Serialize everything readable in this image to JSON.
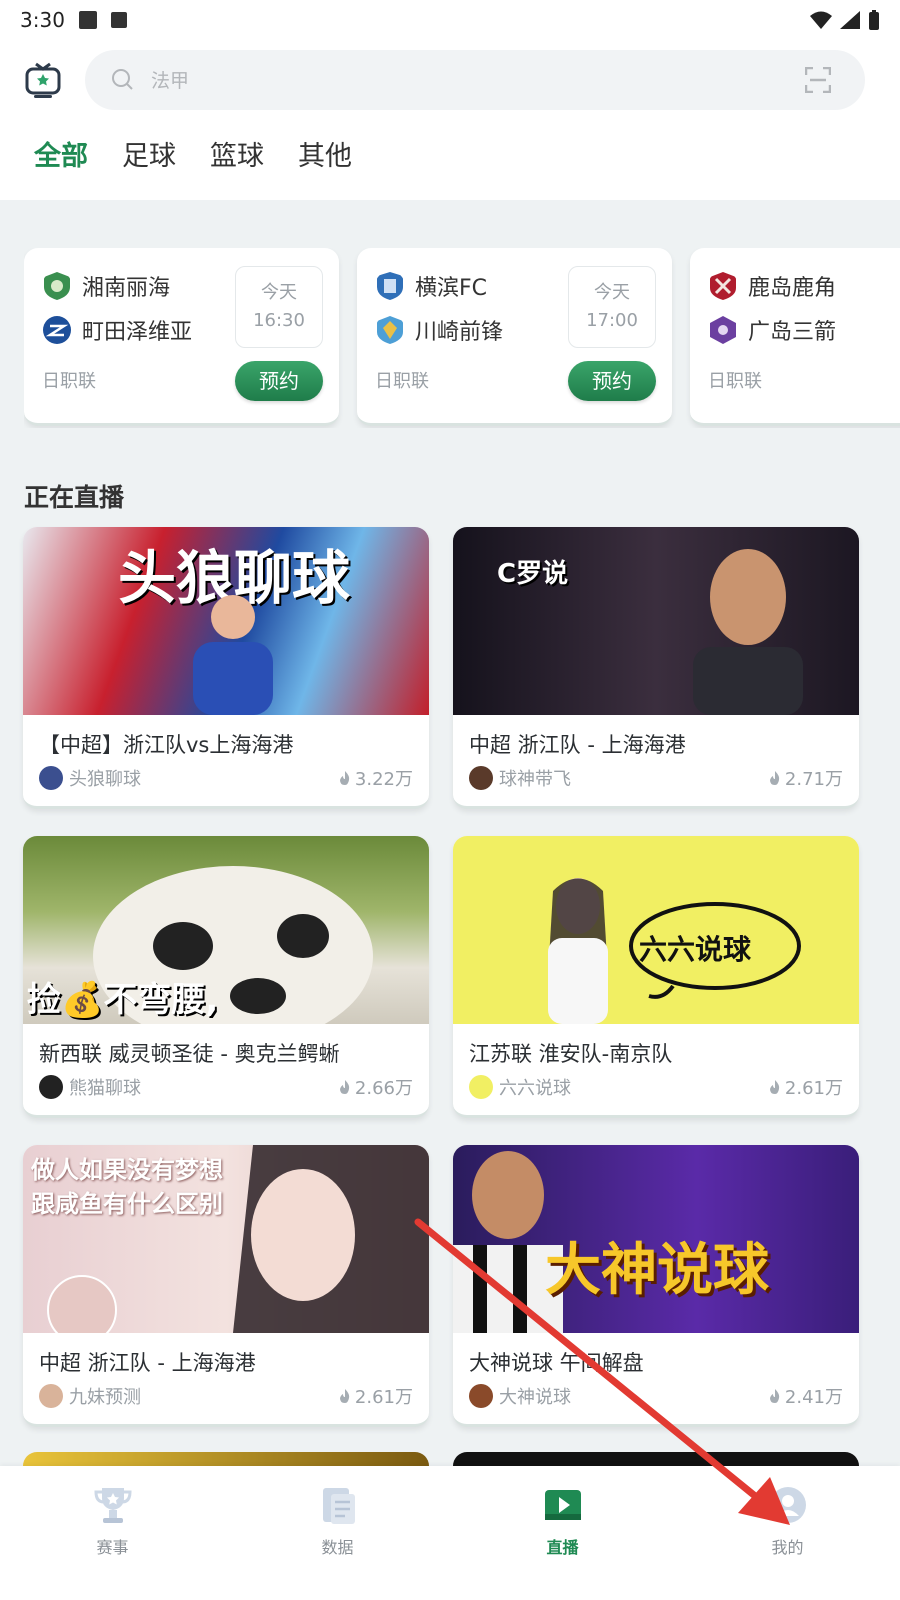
{
  "status": {
    "time": "3:30"
  },
  "search": {
    "placeholder": "法甲"
  },
  "tabs": [
    {
      "label": "全部",
      "active": true
    },
    {
      "label": "足球",
      "active": false
    },
    {
      "label": "篮球",
      "active": false
    },
    {
      "label": "其他",
      "active": false
    }
  ],
  "matches": [
    {
      "home": "湘南丽海",
      "away": "町田泽维亚",
      "day": "今天",
      "time": "16:30",
      "league": "日职联",
      "action": "预约"
    },
    {
      "home": "横滨FC",
      "away": "川崎前锋",
      "day": "今天",
      "time": "17:00",
      "league": "日职联",
      "action": "预约"
    },
    {
      "home": "鹿岛鹿角",
      "away": "广岛三箭",
      "league": "日职联"
    }
  ],
  "section": {
    "title": "正在直播"
  },
  "live": [
    {
      "title": "【中超】浙江队vs上海海港",
      "streamer": "头狼聊球",
      "views": "3.22万",
      "overlay": "头狼聊球"
    },
    {
      "title": "中超  浙江队 - 上海海港",
      "streamer": "球神带飞",
      "views": "2.71万",
      "overlay": "C罗说"
    },
    {
      "title": "新西联  威灵顿圣徒 - 奥克兰鳄蜥",
      "streamer": "熊猫聊球",
      "views": "2.66万",
      "overlay": "捡💰不弯腰,"
    },
    {
      "title": "江苏联   淮安队-南京队",
      "streamer": "六六说球",
      "views": "2.61万",
      "overlay": "六六说球"
    },
    {
      "title": "中超  浙江队 - 上海海港",
      "streamer": "九妹预测",
      "views": "2.61万",
      "overlay": "做人如果没有梦想 跟咸鱼有什么区别"
    },
    {
      "title": "大神说球 午间解盘",
      "streamer": "大神说球",
      "views": "2.41万",
      "overlay": "大神说球"
    }
  ],
  "nav": [
    {
      "label": "赛事",
      "icon": "trophy-icon",
      "active": false
    },
    {
      "label": "数据",
      "icon": "data-icon",
      "active": false
    },
    {
      "label": "直播",
      "icon": "play-icon",
      "active": true
    },
    {
      "label": "我的",
      "icon": "profile-icon",
      "active": false
    }
  ],
  "colors": {
    "accent": "#1f8a53",
    "annotation_arrow": "#e23a32"
  }
}
